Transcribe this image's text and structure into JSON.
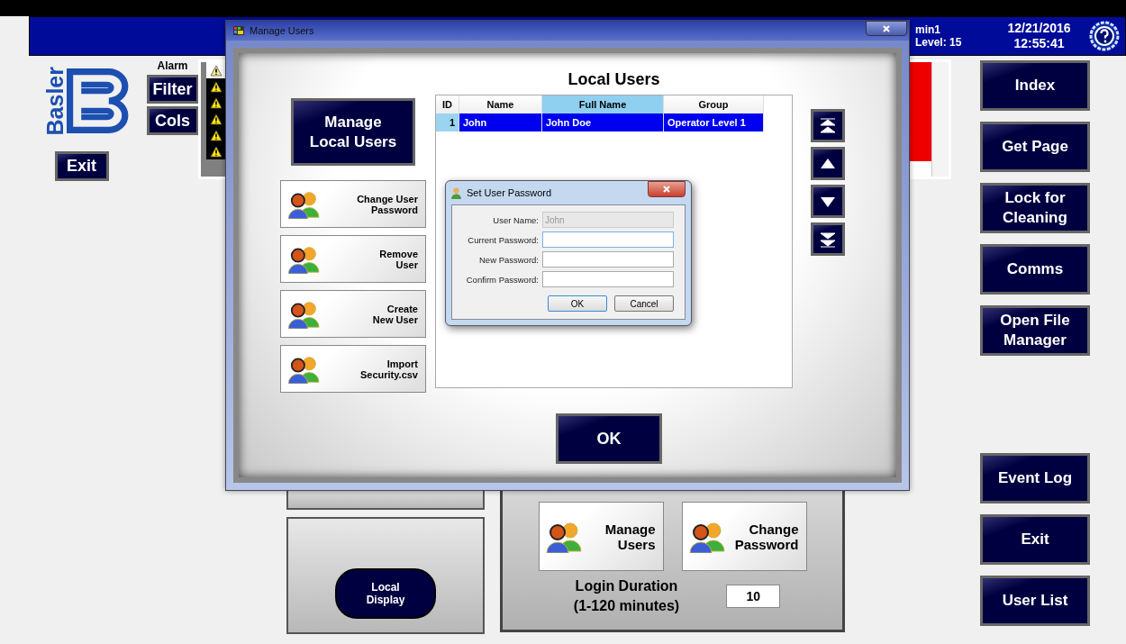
{
  "header": {
    "user": "min1",
    "level": "Level: 15",
    "date": "12/21/2016",
    "time": "12:55:41"
  },
  "logo": {
    "text": "Basler"
  },
  "alarm": {
    "label": "Alarm",
    "buttons": [
      "Filter",
      "Cols"
    ],
    "exit": "Exit",
    "rows": [
      {
        "selected": true
      },
      {
        "selected": false
      },
      {
        "selected": false
      },
      {
        "selected": false
      },
      {
        "selected": false
      },
      {
        "selected": false
      }
    ]
  },
  "nav_top": [
    "Index",
    "Get Page",
    "Lock for Cleaning",
    "Comms",
    "Open File Manager"
  ],
  "nav_bottom": [
    "Event Log",
    "Exit",
    "User List"
  ],
  "local_display": {
    "button": "Local\nDisplay"
  },
  "security_panel": {
    "buttons": [
      "Manage\nUsers",
      "Change\nPassword"
    ],
    "duration_label": "Login Duration\n(1-120 minutes)",
    "duration_value": "10"
  },
  "manage_users_window": {
    "title": "Manage Users",
    "heading": "Local Users",
    "main_button": "Manage\nLocal Users",
    "actions": [
      "Change User\nPassword",
      "Remove\nUser",
      "Create\nNew User",
      "Import\nSecurity.csv"
    ],
    "table": {
      "columns": [
        {
          "label": "ID",
          "selected": false
        },
        {
          "label": "Name",
          "selected": false
        },
        {
          "label": "Full Name",
          "selected": true
        },
        {
          "label": "Group",
          "selected": false
        }
      ],
      "rows": [
        {
          "cells": [
            "1",
            "John",
            "John Doe",
            "Operator Level 1"
          ],
          "selected": true
        }
      ]
    },
    "scroll_buttons": [
      {
        "kind": "first"
      },
      {
        "kind": "up"
      },
      {
        "kind": "down"
      },
      {
        "kind": "last"
      }
    ],
    "ok": "OK"
  },
  "password_dialog": {
    "title": "Set User Password",
    "fields": [
      {
        "label": "User Name:",
        "value": "John",
        "disabled": true,
        "focused": false
      },
      {
        "label": "Current Password:",
        "disabled": false,
        "focused": true
      },
      {
        "label": "New Password:",
        "disabled": false,
        "focused": false
      },
      {
        "label": "Confirm Password:",
        "disabled": false,
        "focused": false
      }
    ],
    "buttons": [
      {
        "label": "OK",
        "default": true
      },
      {
        "label": "Cancel",
        "default": false
      }
    ]
  }
}
